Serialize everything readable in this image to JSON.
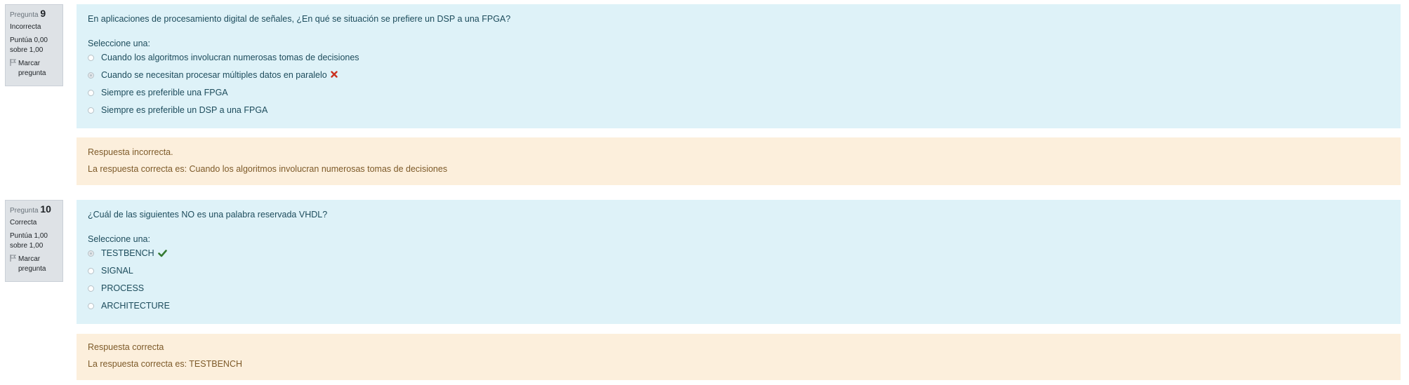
{
  "questions": [
    {
      "info": {
        "label": "Pregunta",
        "number": "9",
        "state": "Incorrecta",
        "grade_line1": "Puntúa 0,00",
        "grade_line2": "sobre 1,00",
        "flag_line1": "Marcar",
        "flag_line2": "pregunta"
      },
      "text": "En aplicaciones de procesamiento digital de señales, ¿En qué se situación se prefiere un DSP a una FPGA?",
      "prompt": "Seleccione una:",
      "answers": [
        "Cuando los algoritmos involucran numerosas tomas de decisiones",
        "Cuando se necesitan procesar múltiples datos en paralelo",
        "Siempre es preferible una FPGA",
        "Siempre es preferible un DSP a una FPGA"
      ],
      "selected_index": 1,
      "feedback": {
        "line1": "Respuesta incorrecta.",
        "line2": "La respuesta correcta es: Cuando los algoritmos involucran numerosas tomas de decisiones"
      }
    },
    {
      "info": {
        "label": "Pregunta",
        "number": "10",
        "state": "Correcta",
        "grade_line1": "Puntúa 1,00",
        "grade_line2": "sobre 1,00",
        "flag_line1": "Marcar",
        "flag_line2": "pregunta"
      },
      "text": "¿Cuál de las siguientes NO es una palabra reservada VHDL?",
      "prompt": "Seleccione una:",
      "answers": [
        "TESTBENCH",
        "SIGNAL",
        "PROCESS",
        "ARCHITECTURE"
      ],
      "selected_index": 0,
      "feedback": {
        "line1": "Respuesta correcta",
        "line2": "La respuesta correcta es: TESTBENCH"
      }
    }
  ],
  "colors": {
    "content_bg": "#def2f8",
    "feedback_bg": "#fcefdc",
    "info_bg": "#dee2e6",
    "incorrect": "#ca3120",
    "correct": "#357a32"
  },
  "icons": {
    "flag": "flag-icon",
    "incorrect": "times-icon",
    "correct": "check-icon"
  }
}
